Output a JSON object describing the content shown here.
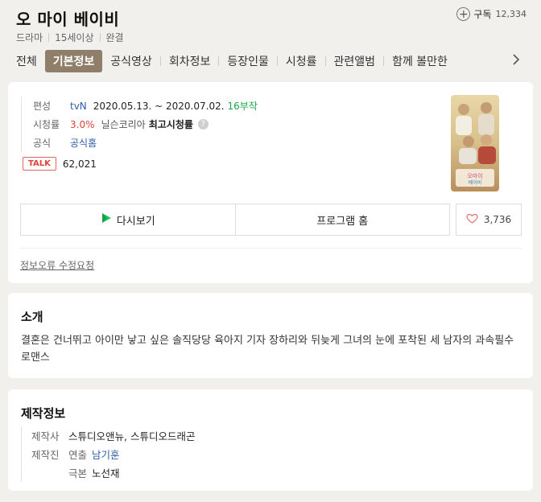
{
  "header": {
    "title": "오 마이 베이비",
    "subscribe_label": "구독",
    "subscribe_count": "12,334",
    "meta": [
      "드라마",
      "15세이상",
      "완결"
    ]
  },
  "tabs": [
    "전체",
    "기본정보",
    "공식영상",
    "회차정보",
    "등장인물",
    "시청률",
    "관련앨범",
    "함께 볼만한"
  ],
  "active_tab": "기본정보",
  "info": {
    "broadcast_key": "편성",
    "channel": "tvN",
    "dates": "2020.05.13. ~ 2020.07.02.",
    "episodes": "16부작",
    "rating_key": "시청률",
    "rating_value": "3.0%",
    "rating_source": "닐슨코리아",
    "rating_label": "최고시청률",
    "official_key": "공식",
    "official_link": "공식홈",
    "talk_badge": "TALK",
    "talk_count": "62,021"
  },
  "poster": {
    "title_text": "오 마이 베이비"
  },
  "buttons": {
    "replay": "다시보기",
    "program_home": "프로그램 홈",
    "like_count": "3,736"
  },
  "report_link": "정보오류 수정요청",
  "intro": {
    "title": "소개",
    "text": "결혼은 건너뛰고 아이만 낳고 싶은 솔직당당 육아지 기자 장하리와 뒤늦게 그녀의 눈에 포착된 세 남자의 과속필수 로맨스"
  },
  "production": {
    "title": "제작정보",
    "company_key": "제작사",
    "company_value": "스튜디오앤뉴, 스튜디오드래곤",
    "staff_key": "제작진",
    "director_label": "연출",
    "director_name": "남기훈",
    "writer_label": "극본",
    "writer_name": "노선재"
  },
  "colors": {
    "accent_tab": "#8f7e6a",
    "link": "#2f5ea8",
    "rating_red": "#e0433a",
    "episodes_green": "#1aa84a"
  },
  "icons": {
    "subscribe": "plus-circle-icon",
    "rating_help": "question-icon",
    "replay": "play-icon",
    "like": "heart-icon",
    "tabs_next": "chevron-right-icon"
  }
}
